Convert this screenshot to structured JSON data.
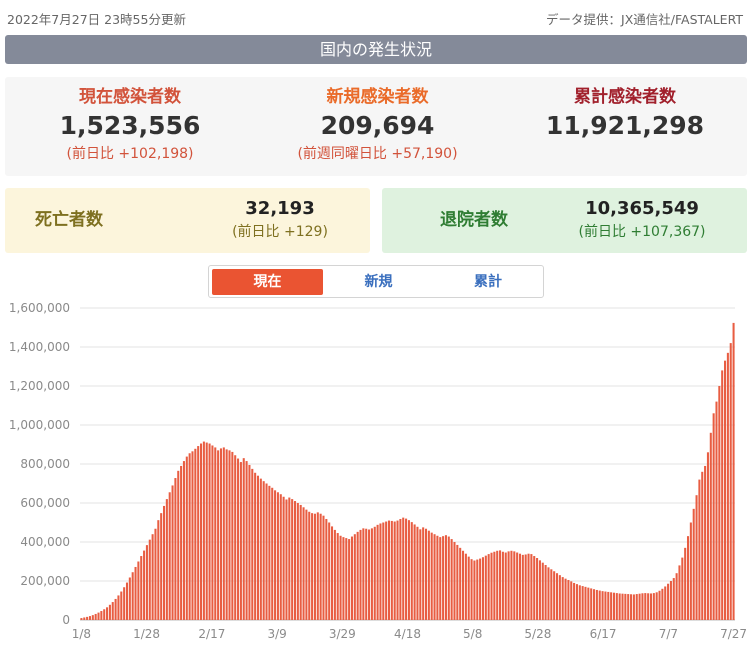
{
  "header": {
    "updated": "2022年7月27日 23時55分更新",
    "source": "データ提供：JX通信社/FASTALERT"
  },
  "title": "国内の発生状況",
  "stats": {
    "current": {
      "label": "現在感染者数",
      "value": "1,523,556",
      "delta": "(前日比 +102,198)"
    },
    "new": {
      "label": "新規感染者数",
      "value": "209,694",
      "delta": "(前週同曜日比 +57,190)"
    },
    "total": {
      "label": "累計感染者数",
      "value": "11,921,298"
    }
  },
  "deaths": {
    "label": "死亡者数",
    "value": "32,193",
    "delta": "(前日比 +129)"
  },
  "discharged": {
    "label": "退院者数",
    "value": "10,365,549",
    "delta": "(前日比 +107,367)"
  },
  "tabs": {
    "current": "現在",
    "new": "新規",
    "total": "累計",
    "active": "current"
  },
  "colors": {
    "bar": "#e85d42",
    "accent": "#ea5432",
    "tab_text": "#3a6fbe"
  },
  "chart_data": {
    "type": "bar",
    "ylim": [
      0,
      1600000
    ],
    "yticks": [
      0,
      200000,
      400000,
      600000,
      800000,
      1000000,
      1200000,
      1400000,
      1600000
    ],
    "ytick_labels": [
      "0",
      "200,000",
      "400,000",
      "600,000",
      "800,000",
      "1,000,000",
      "1,200,000",
      "1,400,000",
      "1,600,000"
    ],
    "xtick_labels": [
      "1/8",
      "1/28",
      "2/17",
      "3/9",
      "3/29",
      "4/18",
      "5/8",
      "5/28",
      "6/17",
      "7/7",
      "7/27"
    ],
    "x_start": "2022-01-08",
    "x_end": "2022-07-27",
    "grid": true,
    "values": [
      10000,
      13000,
      16000,
      20000,
      25000,
      31000,
      38000,
      46000,
      55000,
      65000,
      78000,
      92000,
      108000,
      126000,
      146000,
      168000,
      192000,
      218000,
      245000,
      272000,
      300000,
      328000,
      356000,
      384000,
      412000,
      440000,
      468000,
      512000,
      548000,
      585000,
      620000,
      655000,
      690000,
      728000,
      765000,
      790000,
      815000,
      838000,
      855000,
      865000,
      878000,
      892000,
      905000,
      915000,
      910000,
      905000,
      895000,
      885000,
      870000,
      880000,
      885000,
      875000,
      870000,
      862000,
      845000,
      828000,
      810000,
      830000,
      815000,
      795000,
      775000,
      755000,
      740000,
      725000,
      712000,
      700000,
      688000,
      678000,
      665000,
      655000,
      645000,
      632000,
      618000,
      628000,
      620000,
      610000,
      600000,
      590000,
      578000,
      566000,
      555000,
      548000,
      545000,
      552000,
      545000,
      535000,
      518000,
      500000,
      480000,
      462000,
      446000,
      432000,
      425000,
      420000,
      415000,
      428000,
      440000,
      452000,
      462000,
      470000,
      468000,
      464000,
      470000,
      478000,
      488000,
      495000,
      500000,
      505000,
      510000,
      508000,
      505000,
      510000,
      518000,
      525000,
      520000,
      512000,
      502000,
      490000,
      478000,
      465000,
      475000,
      468000,
      458000,
      448000,
      440000,
      432000,
      425000,
      430000,
      435000,
      428000,
      415000,
      400000,
      385000,
      370000,
      355000,
      340000,
      325000,
      312000,
      305000,
      310000,
      315000,
      322000,
      330000,
      338000,
      345000,
      350000,
      355000,
      357000,
      350000,
      346000,
      352000,
      355000,
      352000,
      346000,
      340000,
      334000,
      336000,
      340000,
      338000,
      328000,
      318000,
      306000,
      294000,
      282000,
      270000,
      260000,
      250000,
      240000,
      230000,
      220000,
      212000,
      205000,
      198000,
      190000,
      184000,
      178000,
      174000,
      170000,
      166000,
      162000,
      158000,
      154000,
      151000,
      148000,
      146000,
      144000,
      142000,
      140000,
      138000,
      136000,
      135000,
      134000,
      133000,
      132000,
      131000,
      133000,
      135000,
      137000,
      138000,
      137000,
      136000,
      138000,
      142000,
      150000,
      160000,
      172000,
      186000,
      200000,
      215000,
      240000,
      280000,
      320000,
      370000,
      430000,
      500000,
      570000,
      640000,
      720000,
      760000,
      790000,
      860000,
      960000,
      1060000,
      1120000,
      1200000,
      1280000,
      1330000,
      1370000,
      1420000,
      1523556
    ]
  }
}
